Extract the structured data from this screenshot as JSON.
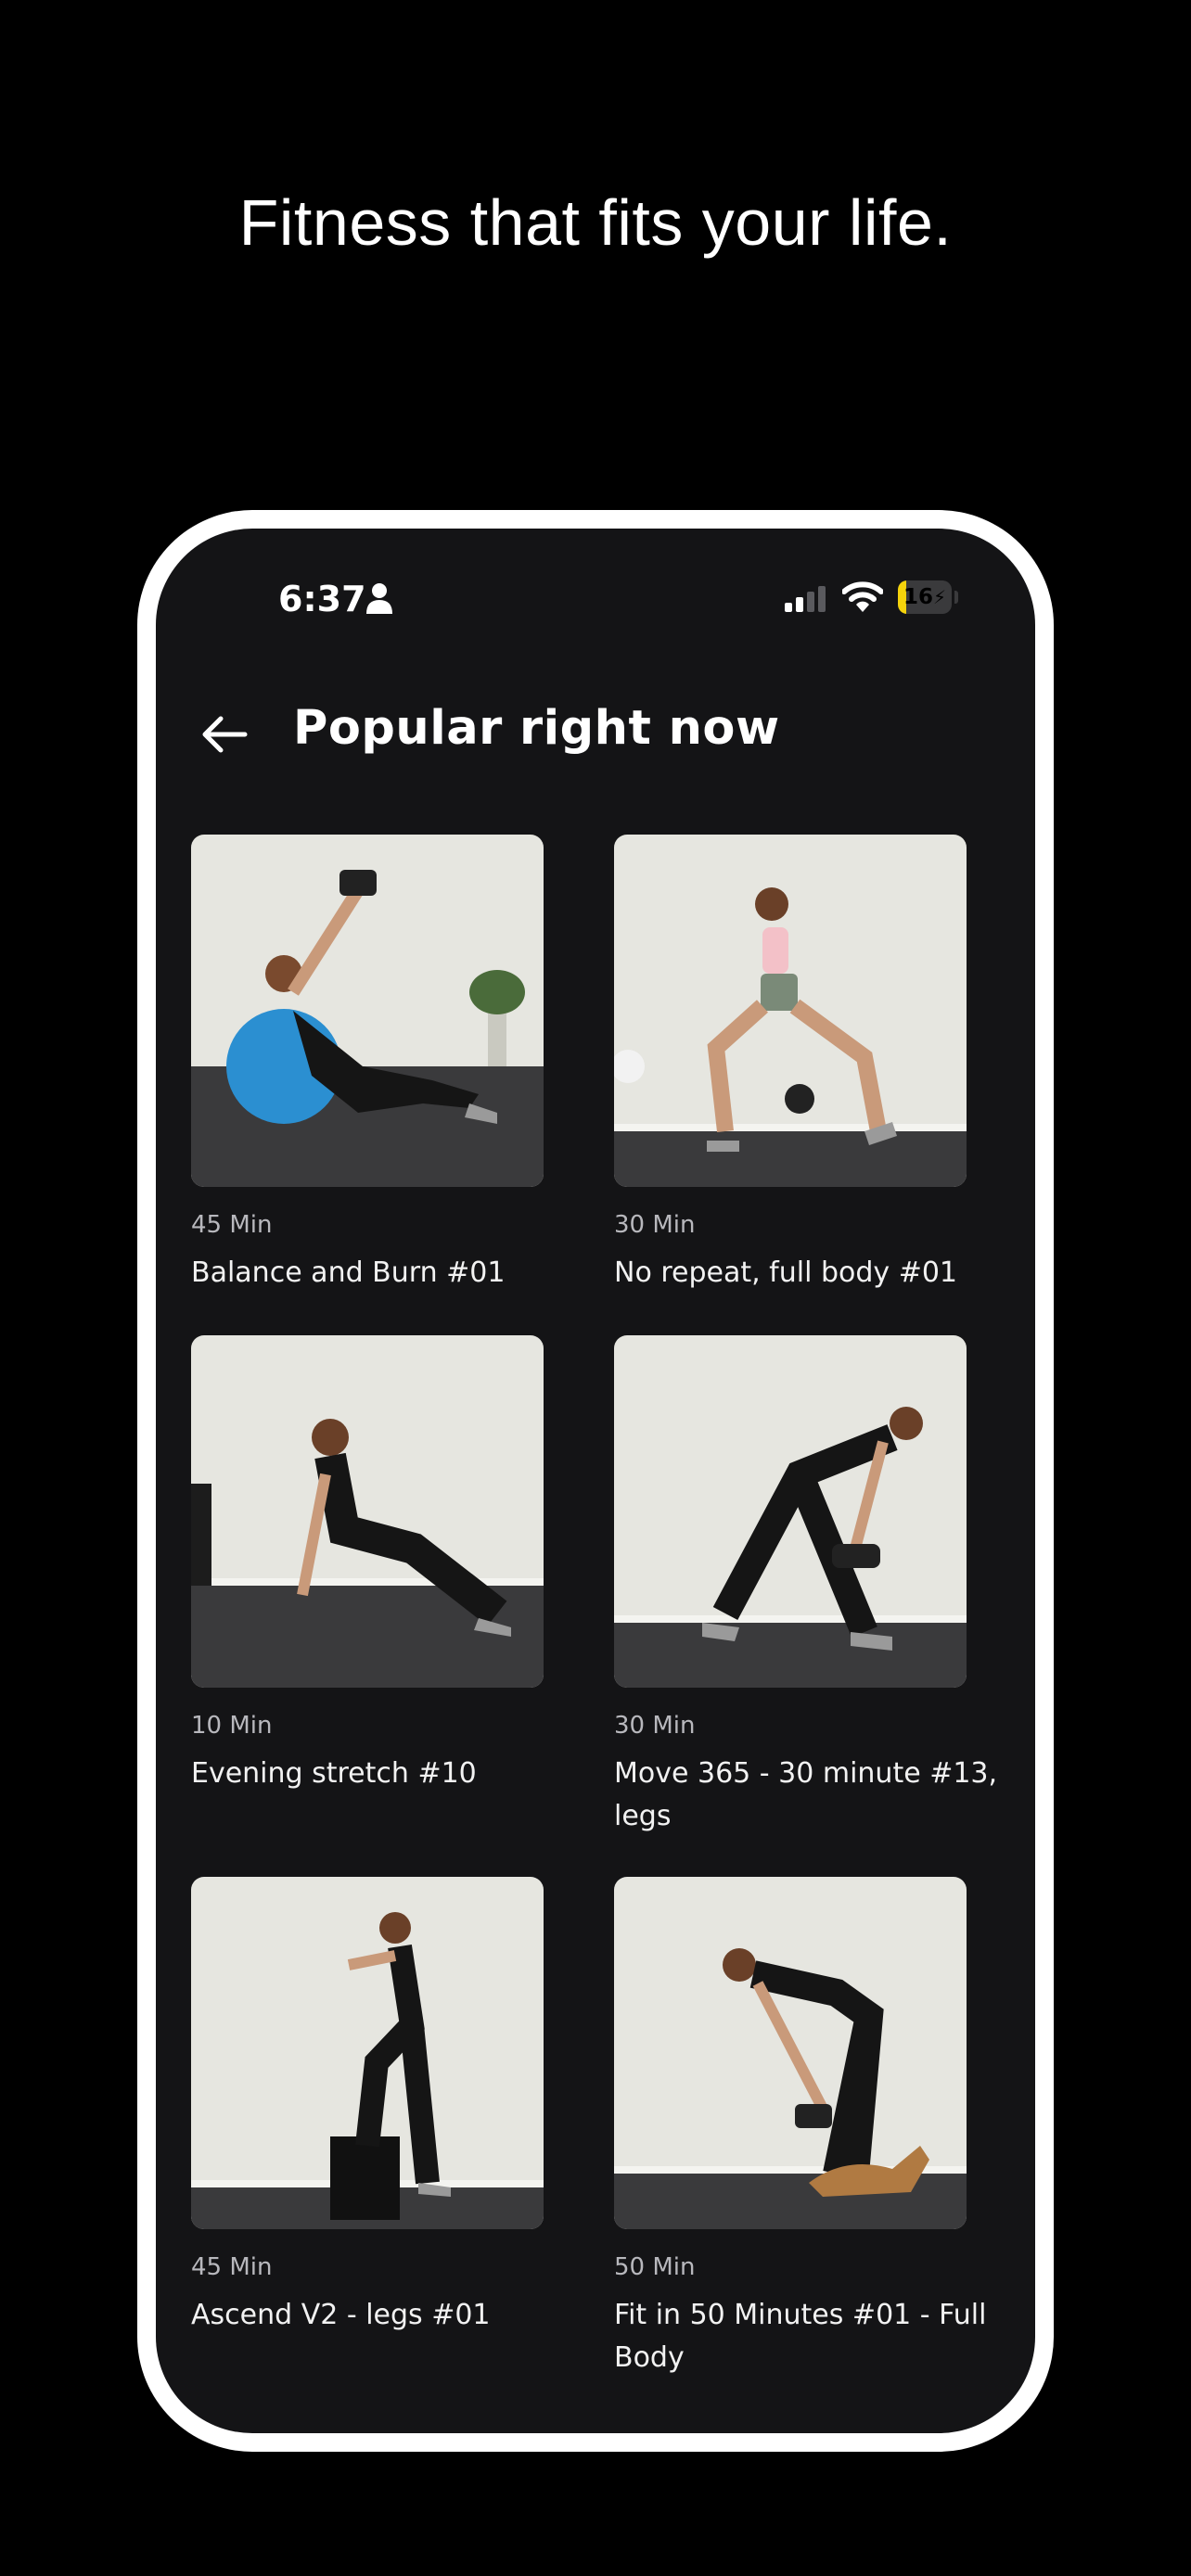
{
  "tagline": "Fitness that fits your life.",
  "status_bar": {
    "time": "6:37",
    "battery_level": "16",
    "battery_fraction": 0.16,
    "icons": [
      "person-icon",
      "cellular-signal-icon",
      "wifi-icon",
      "battery-charging-icon"
    ]
  },
  "header": {
    "back_icon": "arrow-left-icon",
    "title": "Popular right now"
  },
  "workouts": [
    {
      "duration": "45 Min",
      "title": "Balance and Burn #01"
    },
    {
      "duration": "30 Min",
      "title": "No repeat, full body #01"
    },
    {
      "duration": "10 Min",
      "title": "Evening stretch #10"
    },
    {
      "duration": "30 Min",
      "title": "Move 365 - 30 minute #13, legs"
    },
    {
      "duration": "45 Min",
      "title": "Ascend V2 - legs #01"
    },
    {
      "duration": "50 Min",
      "title": "Fit in 50 Minutes #01 - Full Body"
    }
  ],
  "colors": {
    "page_background": "#000000",
    "phone_frame": "#ffffff",
    "screen_background": "#141416",
    "text_primary": "#f2f2f2",
    "text_secondary": "#b8b8bd",
    "battery_accent": "#f5d30b",
    "thumb_wall": "#e6e6e0",
    "thumb_floor": "#3a3a3c"
  }
}
